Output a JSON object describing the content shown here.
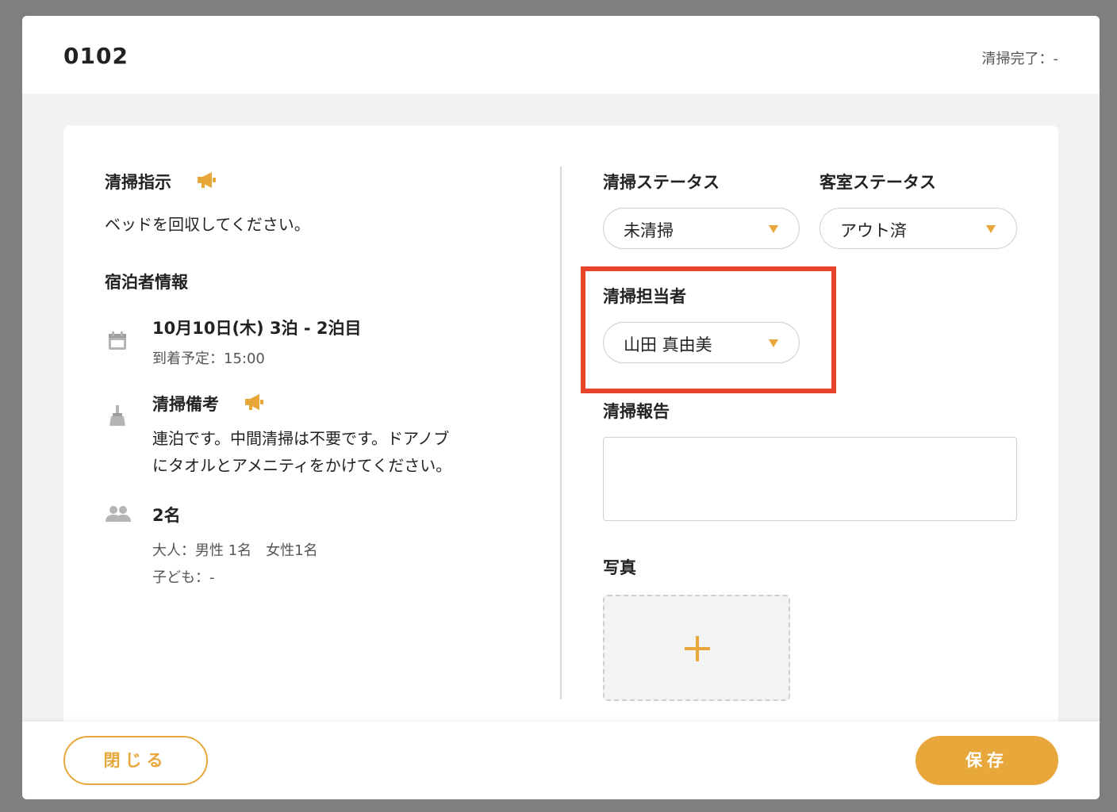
{
  "header": {
    "room_number": "0102",
    "cleaning_complete": "清掃完了：-"
  },
  "left": {
    "instruction_title": "清掃指示",
    "instruction_text": "ベッドを回収してください。",
    "guest_info_title": "宿泊者情報",
    "stay_summary": "10月10日(木) 3泊 - 2泊目",
    "arrival": "到着予定：15:00",
    "cleaning_notes_title": "清掃備考",
    "cleaning_notes_line1": "連泊です。中間清掃は不要です。ドアノブ",
    "cleaning_notes_line2": "にタオルとアメニティをかけてください。",
    "guest_count": "2名",
    "adults": "大人：男性 1名　女性1名",
    "children": "子ども：-"
  },
  "right": {
    "cleaning_status_label": "清掃ステータス",
    "cleaning_status_value": "未清掃",
    "room_status_label": "客室ステータス",
    "room_status_value": "アウト済",
    "assignee_label": "清掃担当者",
    "assignee_value": "山田 真由美",
    "report_label": "清掃報告",
    "report_value": "",
    "photo_label": "写真"
  },
  "footer": {
    "close_label": "閉じる",
    "save_label": "保存"
  },
  "icons": {
    "megaphone": "megaphone-icon",
    "calendar": "calendar-icon",
    "broom": "broom-icon",
    "people": "people-icon",
    "plus": "plus-icon"
  },
  "colors": {
    "accent": "#e8a73a",
    "highlight": "#e8432b"
  }
}
